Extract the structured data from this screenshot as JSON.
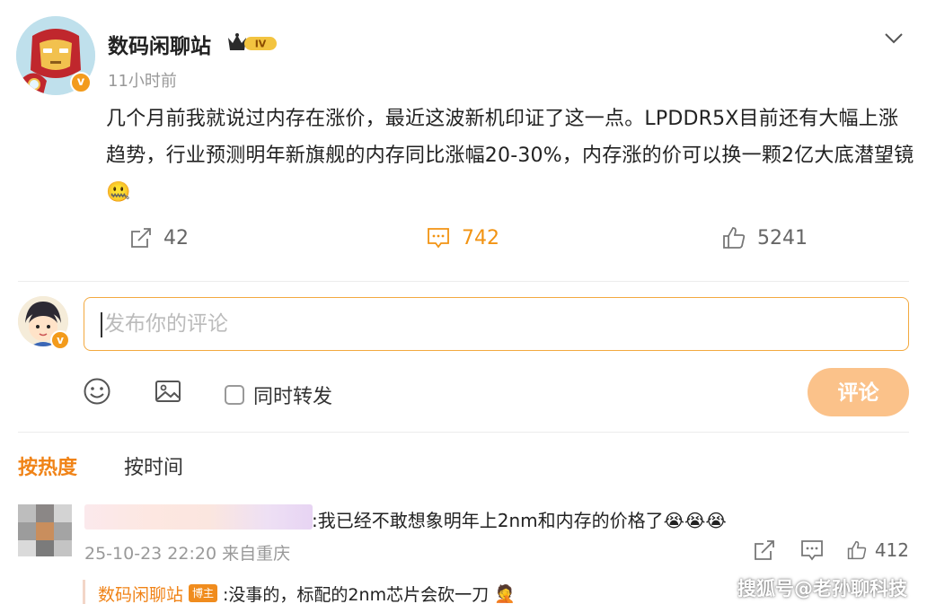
{
  "post": {
    "author": "数码闲聊站",
    "level_badge": "IV",
    "time": "11小时前",
    "text": "几个月前我就说过内存在涨价，最近这波新机印证了这一点。LPDDR5X目前还有大幅上涨趋势，行业预测明年新旗舰的内存同比涨幅20-30%，内存涨的价可以换一颗2亿大底潜望镜",
    "emoji": "🤐",
    "verify_mark": "v"
  },
  "actions": {
    "repost_count": "42",
    "comment_count": "742",
    "like_count": "5241"
  },
  "composer": {
    "placeholder": "发布你的评论",
    "repost_label": "同时转发",
    "submit_label": "评论"
  },
  "sort": {
    "hot": "按热度",
    "time": "按时间"
  },
  "comments": [
    {
      "text": ":我已经不敢想象明年上2nm和内存的价格了",
      "emojis": "😭😭😭",
      "meta": "25-10-23 22:20 来自重庆",
      "like_count": "412"
    }
  ],
  "reply": {
    "author": "数码闲聊站",
    "tag": "博主",
    "text": ":没事的，标配的2nm芯片会砍一刀",
    "emoji": "🤦"
  },
  "watermark": "搜狐号@老孙聊科技",
  "colors": {
    "accent": "#f08317",
    "submit_bg": "#fbc28a",
    "input_border": "#f3a93f"
  }
}
